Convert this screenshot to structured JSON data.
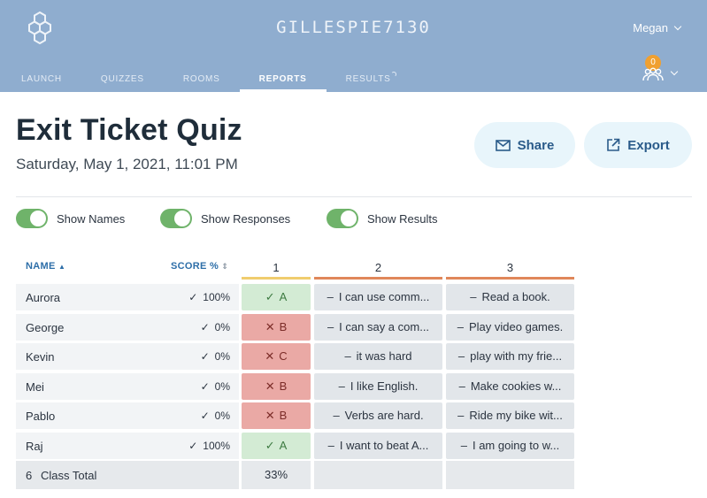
{
  "header": {
    "brand": "GILLESPIE7130",
    "user": "Megan",
    "rooms_badge": "0",
    "nav": [
      "LAUNCH",
      "QUIZZES",
      "ROOMS",
      "REPORTS",
      "RESULTS"
    ]
  },
  "report": {
    "title": "Exit Ticket Quiz",
    "date": "Saturday, May 1, 2021, 11:01 PM",
    "share_label": "Share",
    "export_label": "Export"
  },
  "toggles": [
    "Show Names",
    "Show Responses",
    "Show Results"
  ],
  "table": {
    "name_header": "NAME",
    "score_header": "SCORE %",
    "questions": [
      "1",
      "2",
      "3"
    ],
    "rows": [
      {
        "name": "Aurora",
        "score": "100%",
        "q1": "A",
        "q1_ok": true,
        "q2": "I can use comm...",
        "q3": "Read a book."
      },
      {
        "name": "George",
        "score": "0%",
        "q1": "B",
        "q1_ok": false,
        "q2": "I can say a com...",
        "q3": "Play video games."
      },
      {
        "name": "Kevin",
        "score": "0%",
        "q1": "C",
        "q1_ok": false,
        "q2": "it was hard",
        "q3": "play with my frie..."
      },
      {
        "name": "Mei",
        "score": "0%",
        "q1": "B",
        "q1_ok": false,
        "q2": "I like English.",
        "q3": "Make cookies w..."
      },
      {
        "name": "Pablo",
        "score": "0%",
        "q1": "B",
        "q1_ok": false,
        "q2": "Verbs are hard.",
        "q3": "Ride my bike wit..."
      },
      {
        "name": "Raj",
        "score": "100%",
        "q1": "A",
        "q1_ok": true,
        "q2": "I want to beat A...",
        "q3": "I am going to w..."
      }
    ],
    "total_count": "6",
    "total_label": "Class Total",
    "total_q1": "33%"
  },
  "colors": {
    "header_bg": "#8fadcf",
    "accent": "#2d6ea8",
    "toggle_on": "#6fb36a",
    "correct": "#d3ebd4",
    "incorrect": "#eaa9a5",
    "q1_bar": "#f0cd6e",
    "q2_bar": "#e0875a",
    "q3_bar": "#e0875a"
  }
}
